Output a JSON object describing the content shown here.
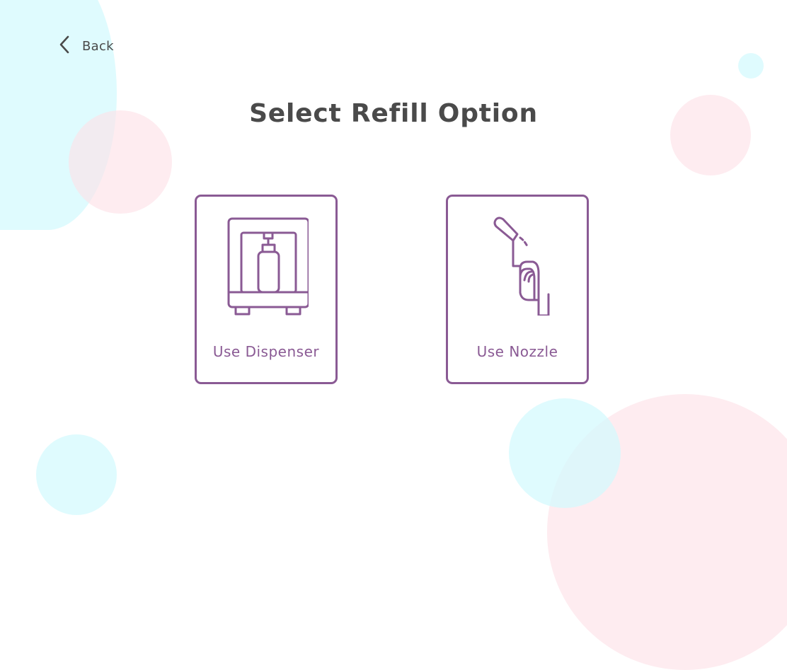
{
  "header": {
    "back_label": "Back",
    "back_icon": "chevron-left-icon"
  },
  "page": {
    "title": "Select Refill Option"
  },
  "options": [
    {
      "label": "Use Dispenser",
      "icon": "dispenser-icon"
    },
    {
      "label": "Use Nozzle",
      "icon": "nozzle-icon"
    }
  ],
  "colors": {
    "accent": "#8a5a94",
    "text": "#4a4a4a",
    "bubble_cyan": "#d2fafd",
    "bubble_pink": "#fde0e7"
  }
}
